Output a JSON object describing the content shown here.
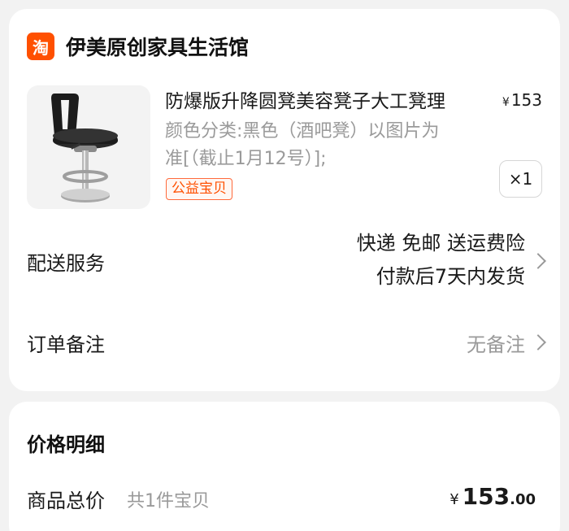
{
  "shop": {
    "logo_char": "淘",
    "name": "伊美原创家具生活馆"
  },
  "product": {
    "title": "防爆版升降圆凳美容凳子大工凳理",
    "price_symbol": "¥",
    "price": "153",
    "sku_line1": "颜色分类:黑色（酒吧凳）以图片为",
    "sku_line2": "准[（截止1月12号）];",
    "tag": "公益宝贝",
    "quantity": "×1",
    "image": "black-bar-stool-image"
  },
  "delivery": {
    "label": "配送服务",
    "line1": "快递 免邮 送运费险",
    "line2": "付款后7天内发货"
  },
  "remark": {
    "label": "订单备注",
    "value": "无备注"
  },
  "price_detail": {
    "title": "价格明细",
    "label": "商品总价",
    "count": "共1件宝贝",
    "symbol": "¥",
    "total_int": "153",
    "total_dec": ".00"
  },
  "colors": {
    "accent": "#ff5000",
    "background": "#f2f2f2",
    "muted_text": "#9a9a9a"
  }
}
